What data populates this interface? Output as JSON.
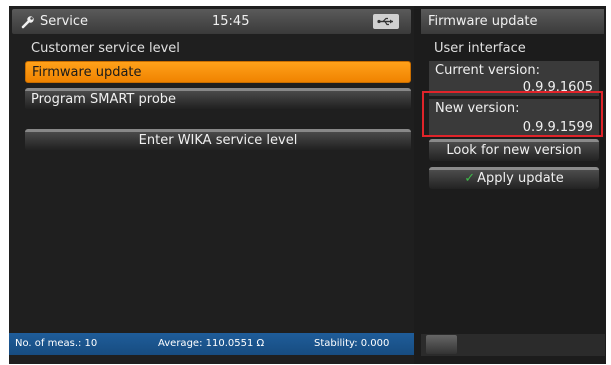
{
  "header": {
    "title": "Service",
    "title_icon": "wrench-icon",
    "clock": "15:45",
    "usb_icon": "usb-icon"
  },
  "left": {
    "section_label": "Customer service level",
    "items": [
      {
        "label": "Firmware update",
        "selected": true
      },
      {
        "label": "Program SMART probe",
        "selected": false
      }
    ],
    "wika_button": "Enter WIKA service level"
  },
  "status_bar": {
    "measurements": "No. of meas.: 10",
    "average": "Average: 110.0551 Ω",
    "stability": "Stability: 0.000"
  },
  "right": {
    "title": "Firmware update",
    "section_label": "User interface",
    "current_version_label": "Current version:",
    "current_version_value": "0.9.9.1605",
    "new_version_label": "New version:",
    "new_version_value": "0.9.9.1599",
    "look_button": "Look for new version",
    "apply_button": "Apply update"
  },
  "colors": {
    "accent": "#f08300",
    "status_bar": "#1f5d9a",
    "highlight": "#e0242a",
    "check": "#3fb84a"
  }
}
